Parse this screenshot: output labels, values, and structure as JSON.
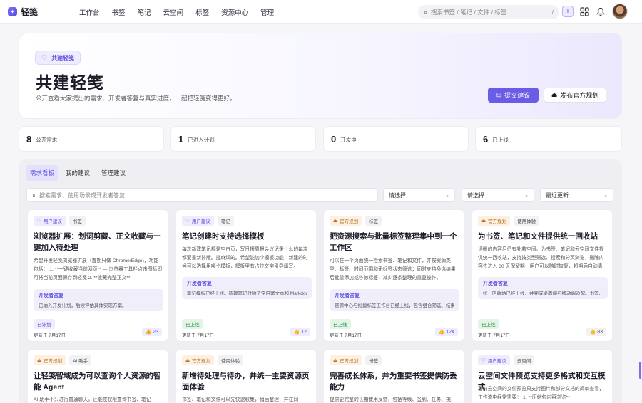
{
  "app": {
    "name": "轻笺",
    "logo_icon": "sparkle-logo-icon",
    "accent": "#6b5ce7"
  },
  "nav": [
    "工作台",
    "书签",
    "笔记",
    "云空间",
    "标签",
    "资源中心",
    "管理"
  ],
  "search": {
    "placeholder": "搜索书签 / 笔记 / 文件 / 标签",
    "shortcut": "/"
  },
  "hero": {
    "badge": "共建轻笺",
    "title": "共建轻笺",
    "subtitle": "公开查看大家提出的需求、开发者答复与真实进度，一起把轻笺变得更好。",
    "submit_label": "提交建议",
    "publish_label": "发布官方规划"
  },
  "stats": [
    {
      "num": "8",
      "label": "公开需求"
    },
    {
      "num": "1",
      "label": "已进入计划"
    },
    {
      "num": "0",
      "label": "开发中"
    },
    {
      "num": "6",
      "label": "已上线"
    }
  ],
  "tabs": [
    "需求看板",
    "我的建议",
    "管理建议"
  ],
  "filters": {
    "search_placeholder": "搜索需求、使用场景或开发者答复",
    "select1": "请选择",
    "select2": "请选择",
    "sort": "最近更新"
  },
  "cards": [
    {
      "type": "用户建议",
      "tag": "书签",
      "title": "浏览器扩展：划词剪藏、正文收藏与一键加入待处理",
      "desc": "希望开发轻笺浏览器扩展（首期只做 Chrome/Edge)，功能包括： 1. **一键收藏当前网页** — 浏览器工具栏点击图标即可将当前页面保存到轻笺 2. **收藏完整正文**",
      "reply_head": "开发者答复",
      "reply": "已纳入开发计划，后续评估具体实现方案。",
      "status": "已计划",
      "updated": "更新于 7月17日",
      "votes": "23"
    },
    {
      "type": "用户建议",
      "tag": "笔记",
      "title": "笔记创建时支持选择模板",
      "desc": "每次新建笔记都是空白页，写日报周报会议记录什么的每次都要重新排版。挺麻烦的。希望能加个模板功能，新建的时候可以选择用哪个模板，模板里有占位文字引导填写。",
      "reply_head": "开发者答复",
      "reply": "笔记模板已经上线。新建笔记时除了空白富文本和 Markdown",
      "status": "已上线",
      "updated": "更新于 7月17日",
      "votes": "12"
    },
    {
      "type": "官方规划",
      "tag": "标签",
      "title": "把资源搜索与批量标签整理集中到一个工作区",
      "desc": "可以在一个页面统一检索书签、笔记和文件，并按资源类型、标签、时间范围和无标签状态筛选；同时支持多选结果后批量添加或移除标签，减少逐条整理的重复操作。",
      "reply_head": "开发者答复",
      "reply": "资源中心与批量标签工作台已经上线，包含组合筛选、结果多选",
      "status": "已上线",
      "updated": "更新于 7月17日",
      "votes": "124"
    },
    {
      "type": "官方规划",
      "tag": "使用体验",
      "title": "为书签、笔记和文件提供统一回收站",
      "desc": "误删的内容后仍有补救空间。为书签、笔记和云空间文件提供统一回收站，支持按类型筛选、搜索和分页浏览，删除内容先进入 30 天保留期，用户可以随时恢复，超期后自动清理。",
      "reply_head": "开发者答复",
      "reply": "统一回收站已经上线，并完成桌面端与移动端适配。书签、笔记",
      "status": "已上线",
      "updated": "更新于 7月17日",
      "votes": "83"
    },
    {
      "type": "官方规划",
      "tag": "AI 助手",
      "title": "让轻笺智域成为可以查询个人资源的智能 Agent",
      "desc": "AI 助手不只进行普通聊天，还能按权限查询书签、笔记"
    },
    {
      "type": "官方规划",
      "tag": "使用体验",
      "title": "新增待处理与待办，并统一主要资源页面体验",
      "desc": "书签、笔记和文件可以先快速收集，稍后整理，并在同一"
    },
    {
      "type": "官方规划",
      "tag": "书签",
      "title": "完善成长体系，并为重要书签提供防丢能力",
      "desc": "提供更完整的长期使用反馈，包括等级、签到、任务、挑"
    },
    {
      "type": "用户建议",
      "tag": "云空间",
      "title": "云空间文件预览支持更多格式和交互模式",
      "desc": "目前云空间的文件预览只支持图片和部分文档的简单查看，工作流中经常需要： 1. **压缩包内容浏览**："
    }
  ]
}
